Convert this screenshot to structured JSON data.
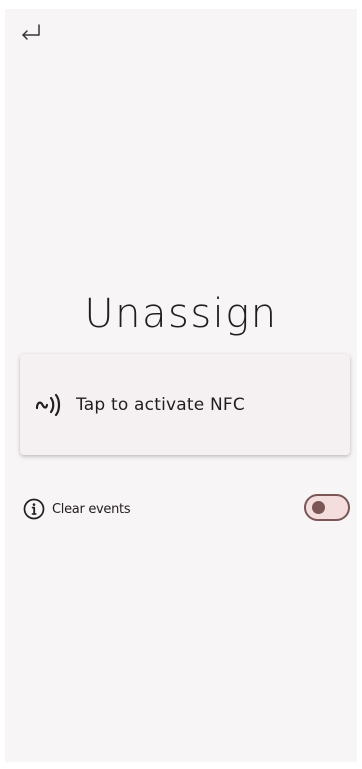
{
  "header": {
    "back_icon": "return-arrow-icon"
  },
  "page": {
    "title": "Unassign"
  },
  "nfc": {
    "icon": "nfc-icon",
    "label": "Tap to activate NFC"
  },
  "options": {
    "clear_events": {
      "icon": "info-icon",
      "label": "Clear events",
      "enabled": false
    }
  },
  "colors": {
    "background": "#f8f5f6",
    "text": "#221d1e",
    "toggle_track": "#f3dddd",
    "toggle_accent": "#7b5656"
  }
}
